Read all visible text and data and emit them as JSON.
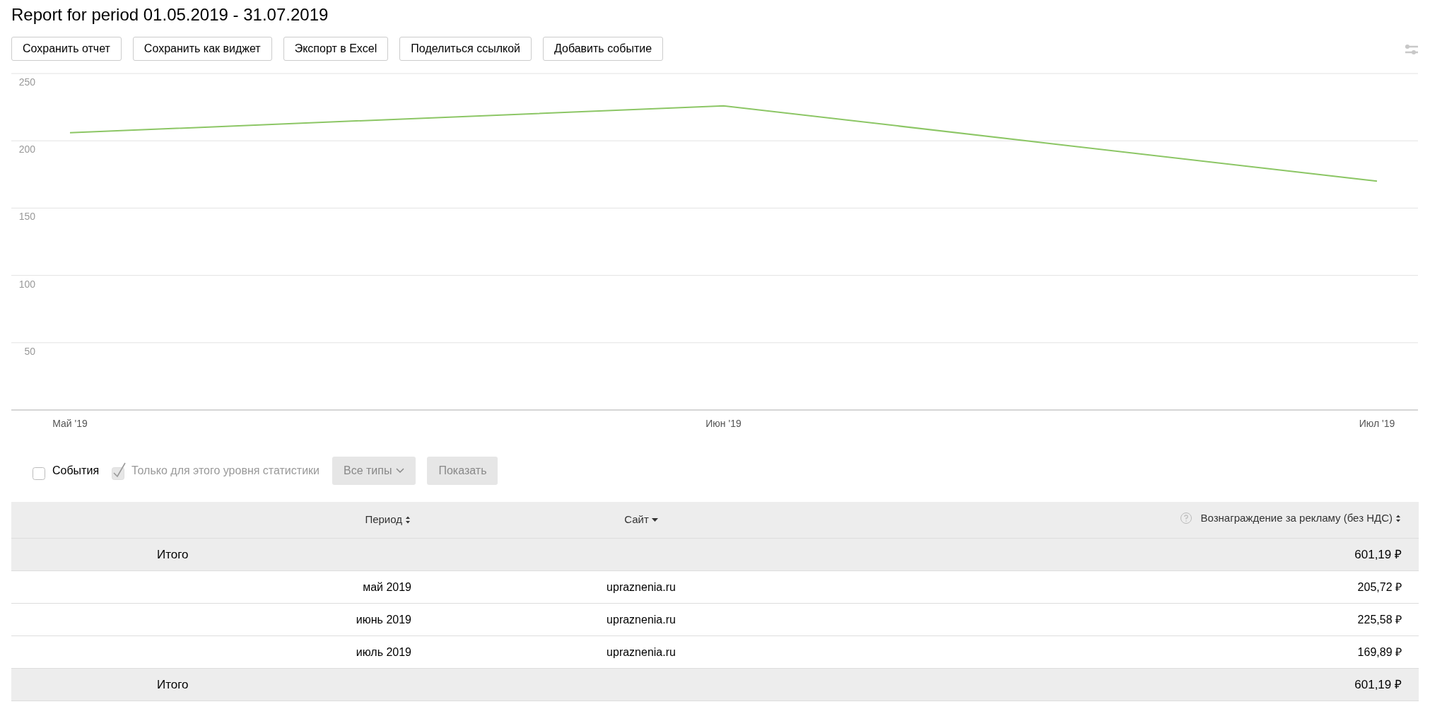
{
  "title": "Report for period 01.05.2019 - 31.07.2019",
  "toolbar": {
    "buttons": [
      {
        "label": "Сохранить отчет"
      },
      {
        "label": "Сохранить как виджет"
      },
      {
        "label": "Экспорт в Excel"
      },
      {
        "label": "Поделиться ссылкой"
      },
      {
        "label": "Добавить событие"
      }
    ]
  },
  "chart": {
    "chart_data": {
      "type": "line",
      "grid": true,
      "categories": [
        "Май '19",
        "Июн '19",
        "Июл '19"
      ],
      "ylim": [
        0,
        250
      ],
      "yticks": [
        50,
        100,
        150,
        200,
        250
      ],
      "series": [
        {
          "color": "#8cc665",
          "values": [
            206,
            226,
            170
          ]
        }
      ]
    }
  },
  "filters": {
    "events": {
      "label": "События",
      "checked": false,
      "disabled": false
    },
    "level_only": {
      "label": "Только для этого уровня статистики",
      "checked": true,
      "disabled": true
    },
    "type_select": {
      "value": "Все типы",
      "disabled": true
    },
    "show_button": {
      "label": "Показать",
      "disabled": true
    }
  },
  "table": {
    "columns": [
      {
        "label": "Период",
        "sorted_desc": false,
        "help": false
      },
      {
        "label": "Сайт",
        "sorted_desc": true,
        "help": false
      },
      {
        "label": "Вознаграждение за рекламу (без НДС)",
        "sorted_desc": false,
        "help": true
      }
    ],
    "rows": [
      {
        "kind": "total",
        "label": "Итого",
        "value": "601,19 ₽"
      },
      {
        "kind": "data",
        "period": "май 2019",
        "site": "upraznenia.ru",
        "value": "205,72 ₽"
      },
      {
        "kind": "data",
        "period": "июнь 2019",
        "site": "upraznenia.ru",
        "value": "225,58 ₽"
      },
      {
        "kind": "data",
        "period": "июль 2019",
        "site": "upraznenia.ru",
        "value": "169,89 ₽"
      },
      {
        "kind": "total",
        "label": "Итого",
        "value": "601,19 ₽"
      }
    ]
  }
}
